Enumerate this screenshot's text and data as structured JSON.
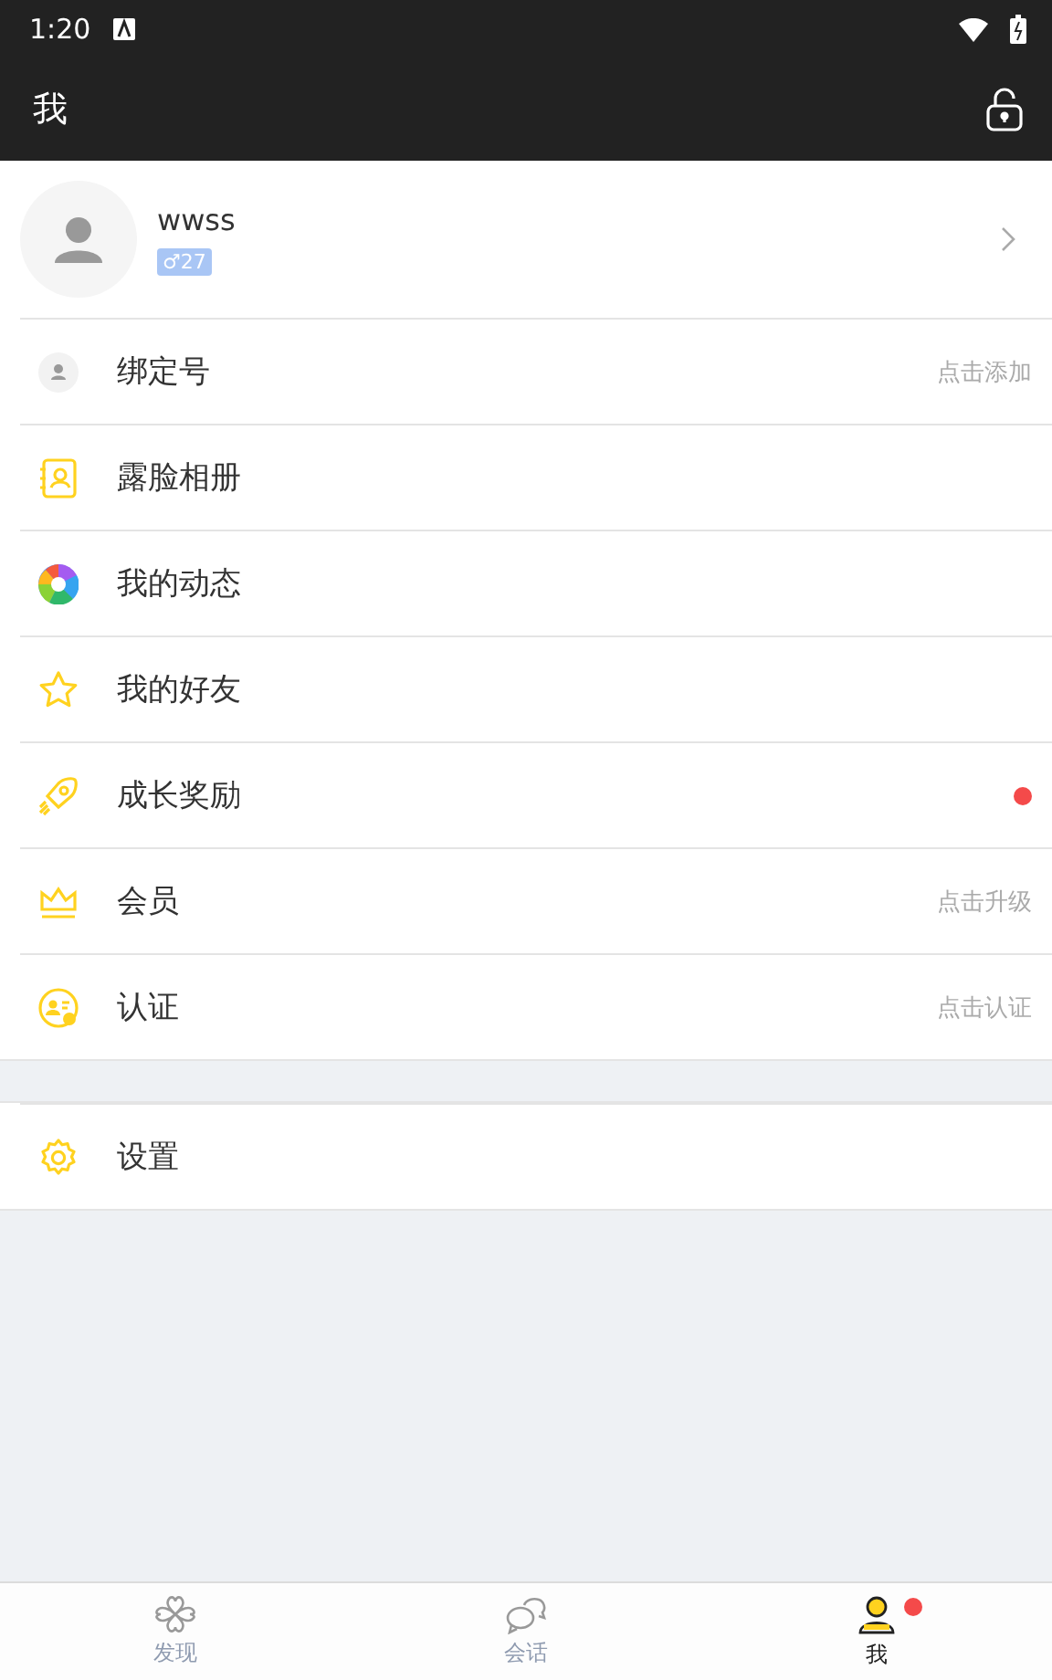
{
  "status_bar": {
    "time": "1:20"
  },
  "app_bar": {
    "title": "我"
  },
  "profile": {
    "name": "wwss",
    "badge": "♂27"
  },
  "menu": [
    {
      "kind": "bind",
      "label": "绑定号",
      "hint": "点击添加",
      "dot": false
    },
    {
      "kind": "album",
      "label": "露脸相册",
      "dot": false
    },
    {
      "kind": "moments",
      "label": "我的动态",
      "dot": false
    },
    {
      "kind": "friends",
      "label": "我的好友",
      "dot": false
    },
    {
      "kind": "rewards",
      "label": "成长奖励",
      "dot": true
    },
    {
      "kind": "vip",
      "label": "会员",
      "hint": "点击升级",
      "dot": false
    },
    {
      "kind": "verify",
      "label": "认证",
      "hint": "点击认证",
      "dot": false
    }
  ],
  "settings": [
    {
      "kind": "settings",
      "label": "设置",
      "dot": false
    }
  ],
  "tabs": [
    {
      "kind": "discover",
      "label": "发现",
      "selected": false,
      "dot": false
    },
    {
      "kind": "chat",
      "label": "会话",
      "selected": false,
      "dot": false
    },
    {
      "kind": "me",
      "label": "我",
      "selected": true,
      "dot": true
    }
  ]
}
